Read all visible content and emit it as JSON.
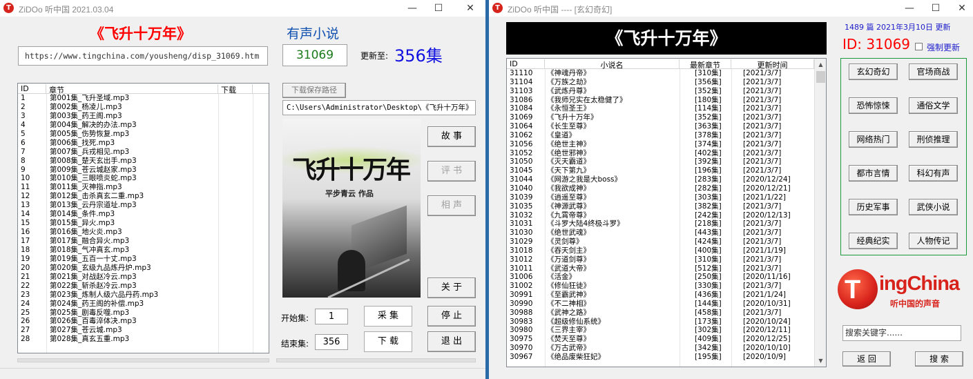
{
  "win1": {
    "title": "ZiDOo 听中国     2021.03.04",
    "heading": "《飞升十万年》",
    "category": "有声小说",
    "url": "https://www.tingchina.com/yousheng/disp_31069.htm",
    "id": "31069",
    "update_label": "更新至:",
    "update_count": "356集",
    "columns": [
      "ID",
      "章节",
      "下载"
    ],
    "chapters": [
      {
        "id": "1",
        "name": "第001集_飞升圣域.mp3"
      },
      {
        "id": "2",
        "name": "第002集_杨凌儿.mp3"
      },
      {
        "id": "3",
        "name": "第003集_药王阁.mp3"
      },
      {
        "id": "4",
        "name": "第004集_解决的办法.mp3"
      },
      {
        "id": "5",
        "name": "第005集_伤势恢复.mp3"
      },
      {
        "id": "6",
        "name": "第006集_找死.mp3"
      },
      {
        "id": "7",
        "name": "第007集_兵戎相见.mp3"
      },
      {
        "id": "8",
        "name": "第008集_楚天玄出手.mp3"
      },
      {
        "id": "9",
        "name": "第009集_苍云城赵家.mp3"
      },
      {
        "id": "10",
        "name": "第010集_三眼喷炎蛇.mp3"
      },
      {
        "id": "11",
        "name": "第011集_灭神指.mp3"
      },
      {
        "id": "12",
        "name": "第012集_击杀真玄二重.mp3"
      },
      {
        "id": "13",
        "name": "第013集_云丹宗道址.mp3"
      },
      {
        "id": "14",
        "name": "第014集_条件.mp3"
      },
      {
        "id": "15",
        "name": "第015集_异火.mp3"
      },
      {
        "id": "16",
        "name": "第016集_地火炎.mp3"
      },
      {
        "id": "17",
        "name": "第017集_融合异火.mp3"
      },
      {
        "id": "18",
        "name": "第018集_气冲真玄.mp3"
      },
      {
        "id": "19",
        "name": "第019集_五百一十丈.mp3"
      },
      {
        "id": "20",
        "name": "第020集_玄级九品炼丹炉.mp3"
      },
      {
        "id": "21",
        "name": "第021集_对战赵冷云.mp3"
      },
      {
        "id": "22",
        "name": "第022集_斩杀赵冷云.mp3"
      },
      {
        "id": "23",
        "name": "第023集_炼制人级六品丹药.mp3"
      },
      {
        "id": "24",
        "name": "第024集_药王阁的补偿.mp3"
      },
      {
        "id": "25",
        "name": "第025集_剧毒反噬.mp3"
      },
      {
        "id": "26",
        "name": "第026集_百毒淬体决.mp3"
      },
      {
        "id": "27",
        "name": "第027集_苍云城.mp3"
      },
      {
        "id": "28",
        "name": "第028集_真玄五重.mp3"
      }
    ],
    "path_button": "下载保存路径",
    "path": "C:\\Users\\Administrator\\Desktop\\《飞升十万年》",
    "cover_title": "飞升十万年",
    "cover_author": "平步青云 作品",
    "btn_story": "故 事",
    "btn_review": "评 书",
    "btn_xiangsheng": "相 声",
    "btn_about": "关 于",
    "btn_collect": "采 集",
    "btn_stop": "停 止",
    "btn_download": "下 载",
    "btn_exit": "退 出",
    "start_label": "开始集:",
    "start_value": "1",
    "end_label": "结束集:",
    "end_value": "356"
  },
  "win2": {
    "title": "ZiDOo 听中国 ---- [玄幻奇幻]",
    "heading": "《飞升十万年》",
    "count_text": "1489 篇   2021年3月10日   更新",
    "id_text": "ID: 31069",
    "force_update": "强制更新",
    "columns": [
      "ID",
      "小说名",
      "最新章节",
      "更新时间"
    ],
    "rows": [
      [
        "31110",
        "《神魂丹帝》",
        "[310集]",
        "[2021/3/7]"
      ],
      [
        "31104",
        "《万族之劫》",
        "[356集]",
        "[2021/3/7]"
      ],
      [
        "31103",
        "《武炼丹尊》",
        "[352集]",
        "[2021/3/7]"
      ],
      [
        "31086",
        "《我师兄实在太稳健了》",
        "[180集]",
        "[2021/3/7]"
      ],
      [
        "31084",
        "《永恒圣王》",
        "[114集]",
        "[2021/3/7]"
      ],
      [
        "31069",
        "《飞升十万年》",
        "[352集]",
        "[2021/3/7]"
      ],
      [
        "31064",
        "《长生至尊》",
        "[363集]",
        "[2021/3/7]"
      ],
      [
        "31062",
        "《皇道》",
        "[378集]",
        "[2021/3/7]"
      ],
      [
        "31056",
        "《绝世主神》",
        "[374集]",
        "[2021/3/7]"
      ],
      [
        "31052",
        "《绝世邪神》",
        "[402集]",
        "[2021/3/7]"
      ],
      [
        "31050",
        "《灭天霸道》",
        "[392集]",
        "[2021/3/7]"
      ],
      [
        "31045",
        "《天下第九》",
        "[196集]",
        "[2021/3/7]"
      ],
      [
        "31044",
        "《网游之我是大boss》",
        "[283集]",
        "[2020/12/24]"
      ],
      [
        "31040",
        "《我欲成神》",
        "[282集]",
        "[2020/12/21]"
      ],
      [
        "31039",
        "《逍遥至尊》",
        "[303集]",
        "[2021/1/22]"
      ],
      [
        "31035",
        "《神源武尊》",
        "[382集]",
        "[2021/3/7]"
      ],
      [
        "31032",
        "《九霄帝尊》",
        "[242集]",
        "[2020/12/13]"
      ],
      [
        "31031",
        "《斗罗大陆4终极斗罗》",
        "[218集]",
        "[2021/3/7]"
      ],
      [
        "31030",
        "《绝世武魂》",
        "[443集]",
        "[2021/3/7]"
      ],
      [
        "31029",
        "《灵剑尊》",
        "[424集]",
        "[2021/3/7]"
      ],
      [
        "31018",
        "《吞天剑主》",
        "[400集]",
        "[2021/1/19]"
      ],
      [
        "31012",
        "《万道剑尊》",
        "[310集]",
        "[2021/3/7]"
      ],
      [
        "31011",
        "《武道大帝》",
        "[512集]",
        "[2021/3/7]"
      ],
      [
        "31006",
        "《活金》",
        "[250集]",
        "[2020/11/16]"
      ],
      [
        "31002",
        "《修仙狂徒》",
        "[330集]",
        "[2021/3/7]"
      ],
      [
        "30991",
        "《至霸武神》",
        "[436集]",
        "[2021/1/24]"
      ],
      [
        "30990",
        "《不二神相》",
        "[144集]",
        "[2020/10/31]"
      ],
      [
        "30988",
        "《武神之路》",
        "[458集]",
        "[2021/3/7]"
      ],
      [
        "30983",
        "《超级修仙系统》",
        "[173集]",
        "[2020/10/24]"
      ],
      [
        "30980",
        "《三界主宰》",
        "[302集]",
        "[2020/12/11]"
      ],
      [
        "30975",
        "《焚天至尊》",
        "[409集]",
        "[2020/12/25]"
      ],
      [
        "30970",
        "《万古武帝》",
        "[342集]",
        "[2020/10/10]"
      ],
      [
        "30967",
        "《绝品废柴狂妃》",
        "[195集]",
        "[2020/10/9]"
      ]
    ],
    "categories": [
      "玄幻奇幻",
      "官场商战",
      "恐怖惊悚",
      "通俗文学",
      "网络热门",
      "刑侦推理",
      "都市言情",
      "科幻有声",
      "历史军事",
      "武侠小说",
      "经典纪实",
      "人物传记"
    ],
    "logo_text": "ingChina",
    "logo_sub": "听中国的声音",
    "search_placeholder": "搜索关键字......",
    "btn_back": "返 回",
    "btn_search": "搜 索"
  },
  "colors": {
    "red": "#ff0000",
    "blue": "#1060c0",
    "green": "#1a7a1a",
    "black": "#000000"
  }
}
